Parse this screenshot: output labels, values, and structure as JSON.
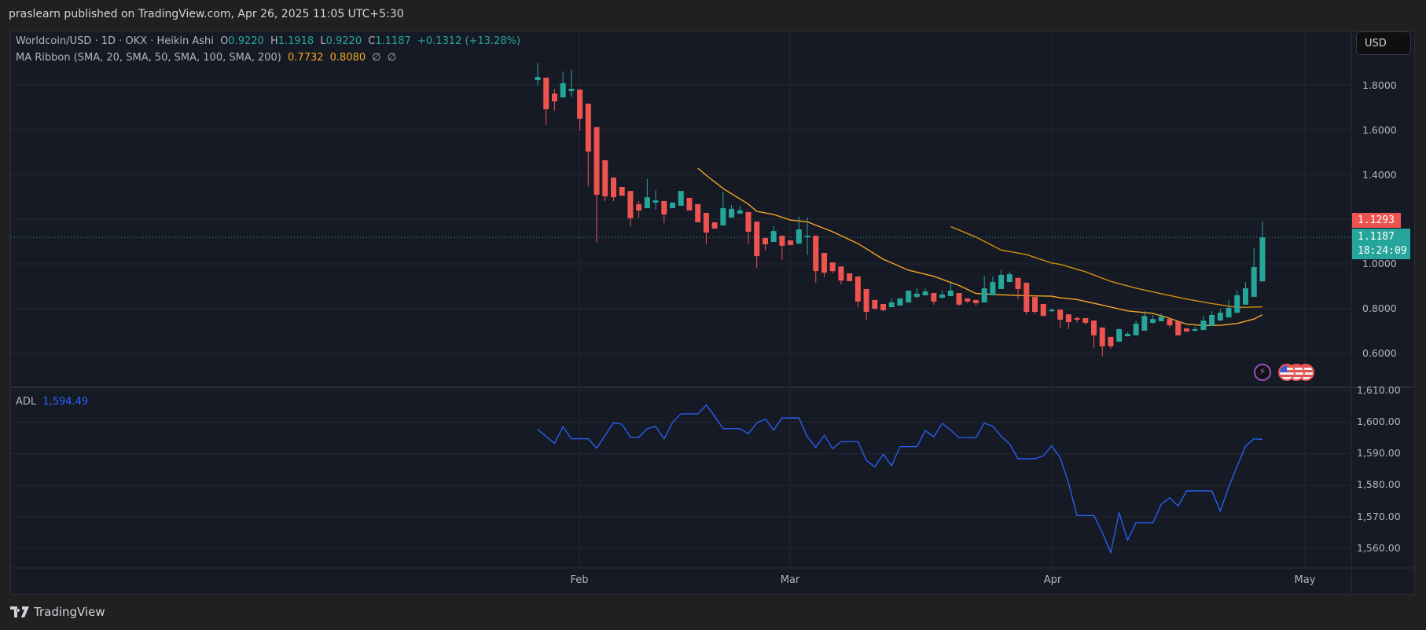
{
  "header": {
    "published": "praslearn published on TradingView.com, Apr 26, 2025 11:05 UTC+5:30"
  },
  "legend": {
    "symbol": "Worldcoin/USD · 1D · OKX · Heikin Ashi",
    "o_label": "O",
    "o": "0.9220",
    "h_label": "H",
    "h": "1.1918",
    "l_label": "L",
    "l": "0.9220",
    "c_label": "C",
    "c": "1.1187",
    "change": "+0.1312 (+13.28%)",
    "ma_title": "MA Ribbon (SMA, 20, SMA, 50, SMA, 100, SMA, 200)",
    "ma1": "0.7732",
    "ma2": "0.8080",
    "ma3": "∅",
    "ma4": "∅"
  },
  "adl": {
    "label": "ADL",
    "value": "1,594.49"
  },
  "currency_button": "USD",
  "price_tags": {
    "high_tag": "1.1293",
    "last_price": "1.1187",
    "countdown": "18:24:09"
  },
  "price_axis": [
    "1.8000",
    "1.6000",
    "1.4000",
    "1.0000",
    "0.8000",
    "0.6000"
  ],
  "adl_axis": [
    "1,610.00",
    "1,600.00",
    "1,590.00",
    "1,580.00",
    "1,570.00",
    "1,560.00"
  ],
  "time_axis": [
    "Feb",
    "Mar",
    "Apr",
    "May"
  ],
  "footer": {
    "brand": "TradingView"
  },
  "colors": {
    "up": "#26a69a",
    "down": "#ef5350",
    "sma20": "#f5a623",
    "sma50": "#d4900f",
    "adl": "#2962ff",
    "grid": "#242833"
  },
  "chart_data": {
    "type": "candlestick",
    "title": "Worldcoin/USD · 1D · OKX · Heikin Ashi",
    "ylim": [
      0.55,
      1.95
    ],
    "candles_ohlc": [
      [
        1.821,
        1.898,
        1.796,
        1.835
      ],
      [
        1.832,
        1.832,
        1.621,
        1.691
      ],
      [
        1.761,
        1.782,
        1.684,
        1.726
      ],
      [
        1.744,
        1.86,
        1.744,
        1.807
      ],
      [
        1.772,
        1.867,
        1.747,
        1.782
      ],
      [
        1.779,
        1.779,
        1.596,
        1.649
      ],
      [
        1.716,
        1.716,
        1.347,
        1.502
      ],
      [
        1.611,
        1.611,
        1.095,
        1.309
      ],
      [
        1.463,
        1.463,
        1.281,
        1.302
      ],
      [
        1.386,
        1.386,
        1.281,
        1.298
      ],
      [
        1.344,
        1.344,
        1.305,
        1.305
      ],
      [
        1.326,
        1.326,
        1.168,
        1.204
      ],
      [
        1.267,
        1.281,
        1.207,
        1.239
      ],
      [
        1.249,
        1.379,
        1.249,
        1.298
      ],
      [
        1.274,
        1.33,
        1.242,
        1.284
      ],
      [
        1.281,
        1.281,
        1.182,
        1.221
      ],
      [
        1.249,
        1.274,
        1.249,
        1.274
      ],
      [
        1.26,
        1.326,
        1.26,
        1.326
      ],
      [
        1.295,
        1.295,
        1.239,
        1.239
      ],
      [
        1.267,
        1.267,
        1.186,
        1.186
      ],
      [
        1.228,
        1.228,
        1.088,
        1.14
      ],
      [
        1.186,
        1.186,
        1.158,
        1.158
      ],
      [
        1.172,
        1.323,
        1.172,
        1.249
      ],
      [
        1.207,
        1.263,
        1.207,
        1.246
      ],
      [
        1.225,
        1.26,
        1.225,
        1.239
      ],
      [
        1.232,
        1.232,
        1.088,
        1.144
      ],
      [
        1.189,
        1.189,
        0.982,
        1.035
      ],
      [
        1.116,
        1.116,
        1.06,
        1.088
      ],
      [
        1.098,
        1.168,
        1.098,
        1.147
      ],
      [
        1.126,
        1.126,
        1.018,
        1.081
      ],
      [
        1.105,
        1.105,
        1.084,
        1.084
      ],
      [
        1.091,
        1.211,
        1.088,
        1.154
      ],
      [
        1.124,
        1.207,
        1.039,
        1.126
      ],
      [
        1.126,
        1.126,
        0.916,
        0.968
      ],
      [
        1.049,
        1.049,
        0.94,
        0.961
      ],
      [
        1.007,
        1.007,
        0.958,
        0.968
      ],
      [
        0.989,
        0.989,
        0.909,
        0.926
      ],
      [
        0.958,
        0.958,
        0.923,
        0.923
      ],
      [
        0.944,
        0.944,
        0.807,
        0.832
      ],
      [
        0.888,
        0.888,
        0.751,
        0.786
      ],
      [
        0.839,
        0.839,
        0.796,
        0.8
      ],
      [
        0.821,
        0.821,
        0.789,
        0.793
      ],
      [
        0.807,
        0.846,
        0.807,
        0.828
      ],
      [
        0.814,
        0.846,
        0.814,
        0.846
      ],
      [
        0.828,
        0.881,
        0.828,
        0.881
      ],
      [
        0.853,
        0.891,
        0.846,
        0.867
      ],
      [
        0.86,
        0.891,
        0.86,
        0.877
      ],
      [
        0.87,
        0.87,
        0.818,
        0.832
      ],
      [
        0.849,
        0.881,
        0.846,
        0.863
      ],
      [
        0.856,
        0.916,
        0.856,
        0.881
      ],
      [
        0.87,
        0.87,
        0.814,
        0.818
      ],
      [
        0.846,
        0.846,
        0.825,
        0.832
      ],
      [
        0.839,
        0.839,
        0.814,
        0.825
      ],
      [
        0.828,
        0.947,
        0.828,
        0.891
      ],
      [
        0.86,
        0.944,
        0.86,
        0.919
      ],
      [
        0.888,
        0.972,
        0.888,
        0.951
      ],
      [
        0.919,
        0.965,
        0.919,
        0.954
      ],
      [
        0.937,
        0.94,
        0.842,
        0.888
      ],
      [
        0.916,
        0.916,
        0.772,
        0.786
      ],
      [
        0.853,
        0.853,
        0.775,
        0.786
      ],
      [
        0.821,
        0.821,
        0.765,
        0.768
      ],
      [
        0.794,
        0.8,
        0.784,
        0.796
      ],
      [
        0.796,
        0.796,
        0.716,
        0.751
      ],
      [
        0.775,
        0.775,
        0.709,
        0.74
      ],
      [
        0.758,
        0.765,
        0.737,
        0.755
      ],
      [
        0.758,
        0.758,
        0.73,
        0.737
      ],
      [
        0.747,
        0.747,
        0.625,
        0.681
      ],
      [
        0.716,
        0.716,
        0.586,
        0.632
      ],
      [
        0.674,
        0.674,
        0.621,
        0.632
      ],
      [
        0.653,
        0.709,
        0.653,
        0.709
      ],
      [
        0.677,
        0.695,
        0.677,
        0.688
      ],
      [
        0.681,
        0.747,
        0.681,
        0.733
      ],
      [
        0.702,
        0.789,
        0.702,
        0.768
      ],
      [
        0.737,
        0.772,
        0.733,
        0.754
      ],
      [
        0.744,
        0.779,
        0.744,
        0.765
      ],
      [
        0.754,
        0.754,
        0.716,
        0.726
      ],
      [
        0.744,
        0.744,
        0.681,
        0.681
      ],
      [
        0.712,
        0.712,
        0.698,
        0.698
      ],
      [
        0.707,
        0.719,
        0.698,
        0.709
      ],
      [
        0.705,
        0.768,
        0.705,
        0.747
      ],
      [
        0.723,
        0.789,
        0.723,
        0.772
      ],
      [
        0.747,
        0.8,
        0.747,
        0.782
      ],
      [
        0.761,
        0.839,
        0.761,
        0.804
      ],
      [
        0.782,
        0.881,
        0.782,
        0.86
      ],
      [
        0.818,
        0.919,
        0.818,
        0.891
      ],
      [
        0.853,
        1.07,
        0.853,
        0.986
      ],
      [
        0.922,
        1.1918,
        0.922,
        1.1187
      ]
    ],
    "sma20": [
      [
        19,
        1.428
      ],
      [
        20,
        1.396
      ],
      [
        22,
        1.337
      ],
      [
        25,
        1.267
      ],
      [
        26,
        1.235
      ],
      [
        28,
        1.221
      ],
      [
        30,
        1.196
      ],
      [
        32,
        1.188
      ],
      [
        35,
        1.144
      ],
      [
        38,
        1.091
      ],
      [
        41,
        1.021
      ],
      [
        44,
        0.972
      ],
      [
        47,
        0.945
      ],
      [
        50,
        0.904
      ],
      [
        52,
        0.868
      ],
      [
        55,
        0.862
      ],
      [
        58,
        0.858
      ],
      [
        61,
        0.856
      ],
      [
        62,
        0.849
      ],
      [
        64,
        0.841
      ],
      [
        67,
        0.816
      ],
      [
        70,
        0.79
      ],
      [
        73,
        0.779
      ],
      [
        75,
        0.757
      ],
      [
        77,
        0.731
      ],
      [
        79,
        0.725
      ],
      [
        81,
        0.726
      ],
      [
        83,
        0.734
      ],
      [
        85,
        0.754
      ],
      [
        86,
        0.7732
      ]
    ],
    "sma50": [
      [
        49,
        1.167
      ],
      [
        52,
        1.12
      ],
      [
        55,
        1.062
      ],
      [
        58,
        1.042
      ],
      [
        61,
        1.004
      ],
      [
        62,
        0.998
      ],
      [
        65,
        0.965
      ],
      [
        68,
        0.922
      ],
      [
        71,
        0.892
      ],
      [
        74,
        0.867
      ],
      [
        77,
        0.843
      ],
      [
        80,
        0.823
      ],
      [
        83,
        0.806
      ],
      [
        86,
        0.808
      ]
    ],
    "adl": [
      1597.7,
      1595.4,
      1593.3,
      1598.5,
      1594.7,
      1594.7,
      1594.7,
      1591.7,
      1595.8,
      1599.8,
      1599.3,
      1595.2,
      1595.2,
      1597.9,
      1598.6,
      1594.7,
      1599.9,
      1602.6,
      1602.6,
      1602.6,
      1605.4,
      1601.8,
      1597.9,
      1597.9,
      1597.9,
      1596.3,
      1599.7,
      1601.0,
      1597.5,
      1601.3,
      1601.3,
      1601.3,
      1595.3,
      1592.0,
      1595.8,
      1591.6,
      1593.8,
      1593.8,
      1593.8,
      1587.9,
      1585.8,
      1589.8,
      1586.2,
      1592.2,
      1592.2,
      1592.2,
      1597.3,
      1595.3,
      1599.6,
      1597.5,
      1595.1,
      1595.1,
      1595.1,
      1599.7,
      1598.7,
      1595.5,
      1593.1,
      1588.4,
      1588.4,
      1588.4,
      1589.3,
      1592.5,
      1588.7,
      1580.6,
      1570.4,
      1570.4,
      1570.4,
      1565.0,
      1558.7,
      1571.3,
      1562.6,
      1568.1,
      1568.1,
      1568.1,
      1574.0,
      1576.0,
      1573.4,
      1578.2,
      1578.2,
      1578.2,
      1578.2,
      1571.8,
      1579.5,
      1586.0,
      1592.4,
      1594.7,
      1594.49
    ],
    "adl_ylim": [
      1555,
      1612
    ],
    "grid": true
  }
}
